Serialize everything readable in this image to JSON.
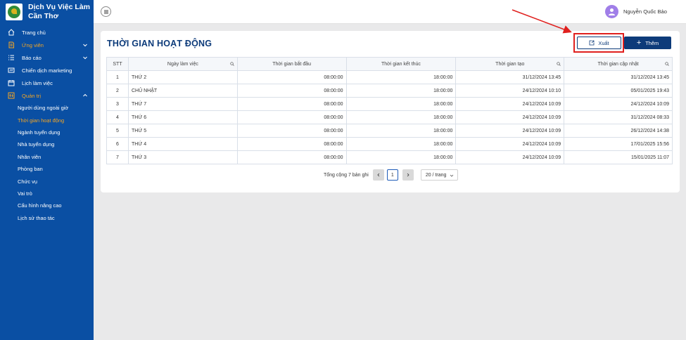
{
  "brand": {
    "line1": "Dịch Vụ Việc Làm",
    "line2": "Cần Thơ"
  },
  "sidebar": {
    "items": [
      {
        "label": "Trang chủ",
        "icon": "home-icon"
      },
      {
        "label": "Ứng viên",
        "icon": "document-icon"
      },
      {
        "label": "Báo cáo",
        "icon": "list-icon"
      },
      {
        "label": "Chiến dịch marketing",
        "icon": "campaign-icon"
      },
      {
        "label": "Lịch làm việc",
        "icon": "calendar-icon"
      },
      {
        "label": "Quản trị",
        "icon": "admin-icon"
      }
    ],
    "subitems": [
      "Người dùng ngoài giờ",
      "Thời gian hoạt động",
      "Ngành tuyển dụng",
      "Nhà tuyển dụng",
      "Nhân viên",
      "Phòng ban",
      "Chức vụ",
      "Vai trò",
      "Cấu hình nâng cao",
      "Lịch sử thao tác"
    ]
  },
  "header": {
    "user_name": "Nguyễn Quốc Bảo"
  },
  "main": {
    "title": "THỜI GIAN HOẠT ĐỘNG",
    "export_label": "Xuất",
    "add_label": "Thêm",
    "columns": [
      "STT",
      "Ngày làm việc",
      "Thời gian bắt đầu",
      "Thời gian kết thúc",
      "Thời gian tạo",
      "Thời gian cập nhật"
    ],
    "rows": [
      {
        "stt": "1",
        "day": "THỨ 2",
        "start": "08:00:00",
        "end": "18:00:00",
        "created": "31/12/2024 13:45",
        "updated": "31/12/2024 13:45"
      },
      {
        "stt": "2",
        "day": "CHỦ NHẬT",
        "start": "08:00:00",
        "end": "18:00:00",
        "created": "24/12/2024 10:10",
        "updated": "05/01/2025 19:43"
      },
      {
        "stt": "3",
        "day": "THỨ 7",
        "start": "08:00:00",
        "end": "18:00:00",
        "created": "24/12/2024 10:09",
        "updated": "24/12/2024 10:09"
      },
      {
        "stt": "4",
        "day": "THỨ 6",
        "start": "08:00:00",
        "end": "18:00:00",
        "created": "24/12/2024 10:09",
        "updated": "31/12/2024 08:33"
      },
      {
        "stt": "5",
        "day": "THỨ 5",
        "start": "08:00:00",
        "end": "18:00:00",
        "created": "24/12/2024 10:09",
        "updated": "26/12/2024 14:38"
      },
      {
        "stt": "6",
        "day": "THỨ 4",
        "start": "08:00:00",
        "end": "18:00:00",
        "created": "24/12/2024 10:09",
        "updated": "17/01/2025 15:56"
      },
      {
        "stt": "7",
        "day": "THỨ 3",
        "start": "08:00:00",
        "end": "18:00:00",
        "created": "24/12/2024 10:09",
        "updated": "15/01/2025 11:07"
      }
    ],
    "pagination": {
      "total_text": "Tổng cộng 7 bản ghi",
      "current_page": "1",
      "page_size": "20 / trang"
    }
  },
  "colors": {
    "sidebar": "#0a4fa3",
    "accent": "#f5a623",
    "primary": "#0d3b7a",
    "highlight": "#e0201e"
  }
}
